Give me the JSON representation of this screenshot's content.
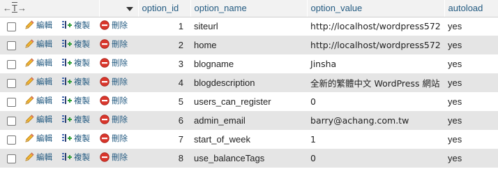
{
  "header": {
    "corner_left_arrow": "←",
    "corner_t": "T",
    "corner_right_arrow": "→",
    "columns": [
      "option_id",
      "option_name",
      "option_value",
      "autoload"
    ]
  },
  "actions": {
    "edit": "編輯",
    "copy": "複製",
    "delete": "刪除"
  },
  "rows": [
    {
      "option_id": "1",
      "option_name": "siteurl",
      "option_value": "http://localhost/wordpress572",
      "autoload": "yes"
    },
    {
      "option_id": "2",
      "option_name": "home",
      "option_value": "http://localhost/wordpress572",
      "autoload": "yes"
    },
    {
      "option_id": "3",
      "option_name": "blogname",
      "option_value": "Jinsha",
      "autoload": "yes"
    },
    {
      "option_id": "4",
      "option_name": "blogdescription",
      "option_value": "全新的繁體中文 WordPress 網站",
      "autoload": "yes"
    },
    {
      "option_id": "5",
      "option_name": "users_can_register",
      "option_value": "0",
      "autoload": "yes"
    },
    {
      "option_id": "6",
      "option_name": "admin_email",
      "option_value": "barry@achang.com.tw",
      "autoload": "yes"
    },
    {
      "option_id": "7",
      "option_name": "start_of_week",
      "option_value": "1",
      "autoload": "yes"
    },
    {
      "option_id": "8",
      "option_name": "use_balanceTags",
      "option_value": "0",
      "autoload": "yes"
    }
  ],
  "colors": {
    "header_bg": "#f2f2f2",
    "header_text": "#235a81",
    "row_alt_bg": "#e5e5e5",
    "delete_red": "#d9352b",
    "edit_pencil": "#e8a31c"
  },
  "icons": {
    "edit": "pencil-icon",
    "copy": "copy-insert-icon",
    "delete": "delete-circle-icon",
    "sort": "sort-down-triangle-icon"
  }
}
